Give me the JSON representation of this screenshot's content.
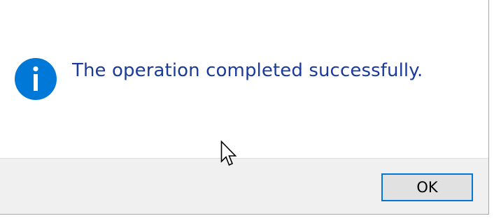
{
  "background_text": {
    "left": "",
    "right": ""
  },
  "dialog": {
    "message": "The operation completed successfully.",
    "icon": "info-icon",
    "ok_label": "OK"
  },
  "colors": {
    "message_text": "#1b3a9c",
    "icon_fill": "#0078d7",
    "button_border": "#0078d7",
    "footer_bg": "#f0f0f0"
  }
}
